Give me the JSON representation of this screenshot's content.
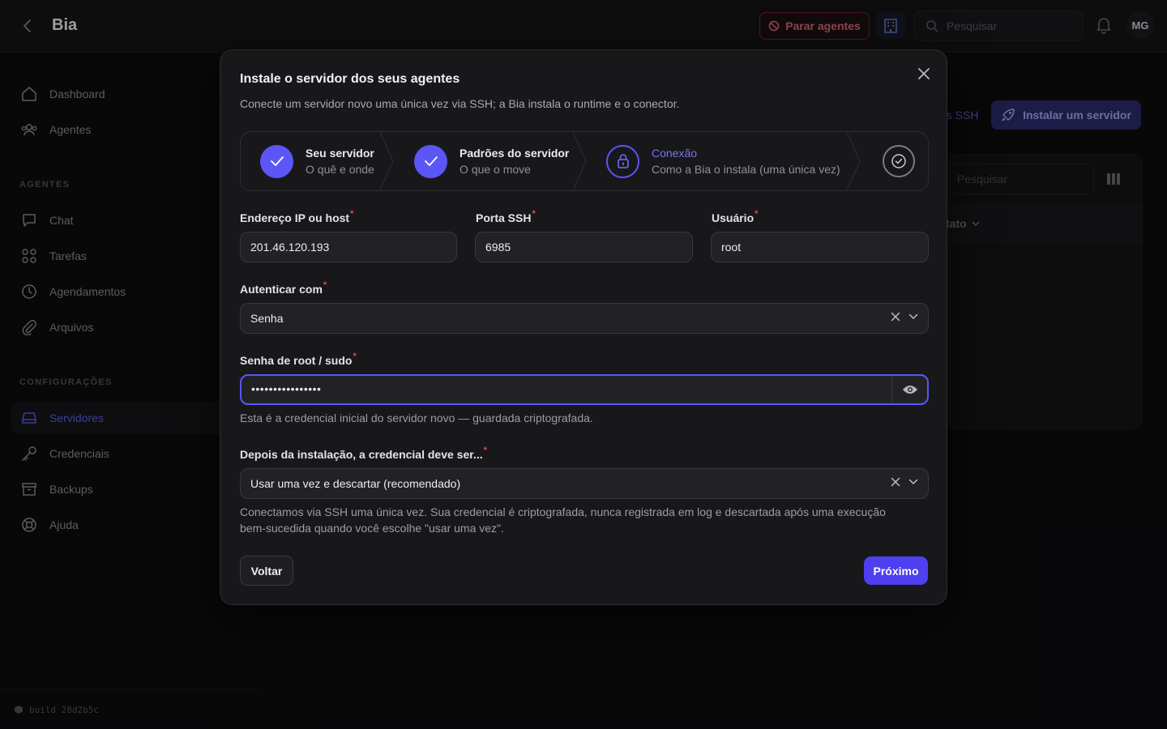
{
  "app": {
    "title": "Bia",
    "stop_agents_label": "Parar agentes",
    "search_placeholder": "Pesquisar",
    "avatar_initials": "MG",
    "build_label": "build 28d2b5c"
  },
  "sidebar": {
    "items_top": [
      {
        "label": "Dashboard",
        "icon": "home-icon"
      },
      {
        "label": "Agentes",
        "icon": "users-icon"
      }
    ],
    "section_agents": "AGENTES",
    "items_agents": [
      {
        "label": "Chat",
        "icon": "chat-icon"
      },
      {
        "label": "Tarefas",
        "icon": "grid-icon"
      },
      {
        "label": "Agendamentos",
        "icon": "clock-icon"
      },
      {
        "label": "Arquivos",
        "icon": "paperclip-icon"
      }
    ],
    "section_config": "CONFIGURAÇÕES",
    "items_config": [
      {
        "label": "Servidores",
        "icon": "server-icon",
        "active": true
      },
      {
        "label": "Credenciais",
        "icon": "key-icon"
      },
      {
        "label": "Backups",
        "icon": "archive-icon"
      },
      {
        "label": "Ajuda",
        "icon": "lifebuoy-icon"
      }
    ]
  },
  "background": {
    "ssh_link_fragment": "es SSH",
    "install_server_label": "Instalar um servidor",
    "panel_search_placeholder": "Pesquisar",
    "column_header_fragment": "tato"
  },
  "modal": {
    "title": "Instale o servidor dos seus agentes",
    "subtitle": "Conecte um servidor novo uma única vez via SSH; a Bia instala o runtime e o conector.",
    "steps": [
      {
        "name": "Seu servidor",
        "desc": "O quê e onde",
        "state": "done"
      },
      {
        "name": "Padrões do servidor",
        "desc": "O que o move",
        "state": "done"
      },
      {
        "name": "Conexão",
        "desc": "Como a Bia o instala (uma única vez)",
        "state": "current"
      }
    ],
    "fields": {
      "host_label": "Endereço IP ou host",
      "host_value": "201.46.120.193",
      "port_label": "Porta SSH",
      "port_value": "6985",
      "user_label": "Usuário",
      "user_value": "root",
      "auth_label": "Autenticar com",
      "auth_value": "Senha",
      "password_label": "Senha de root / sudo",
      "password_value": "••••••••••••••••",
      "password_hint": "Esta é a credencial inicial do servidor novo — guardada criptografada.",
      "after_label": "Depois da instalação, a credencial deve ser...",
      "after_value": "Usar uma vez e descartar (recomendado)",
      "after_hint_line1": "Conectamos via SSH uma única vez. Sua credencial é criptografada, nunca registrada em log e descartada após uma execução",
      "after_hint_line2": "bem-sucedida quando você escolhe \"usar uma vez\"."
    },
    "back_label": "Voltar",
    "next_label": "Próximo"
  },
  "colors": {
    "accent": "#5b56f5",
    "primary_button": "#4e3ff0",
    "danger": "#e06a74",
    "required": "#e5484d"
  }
}
